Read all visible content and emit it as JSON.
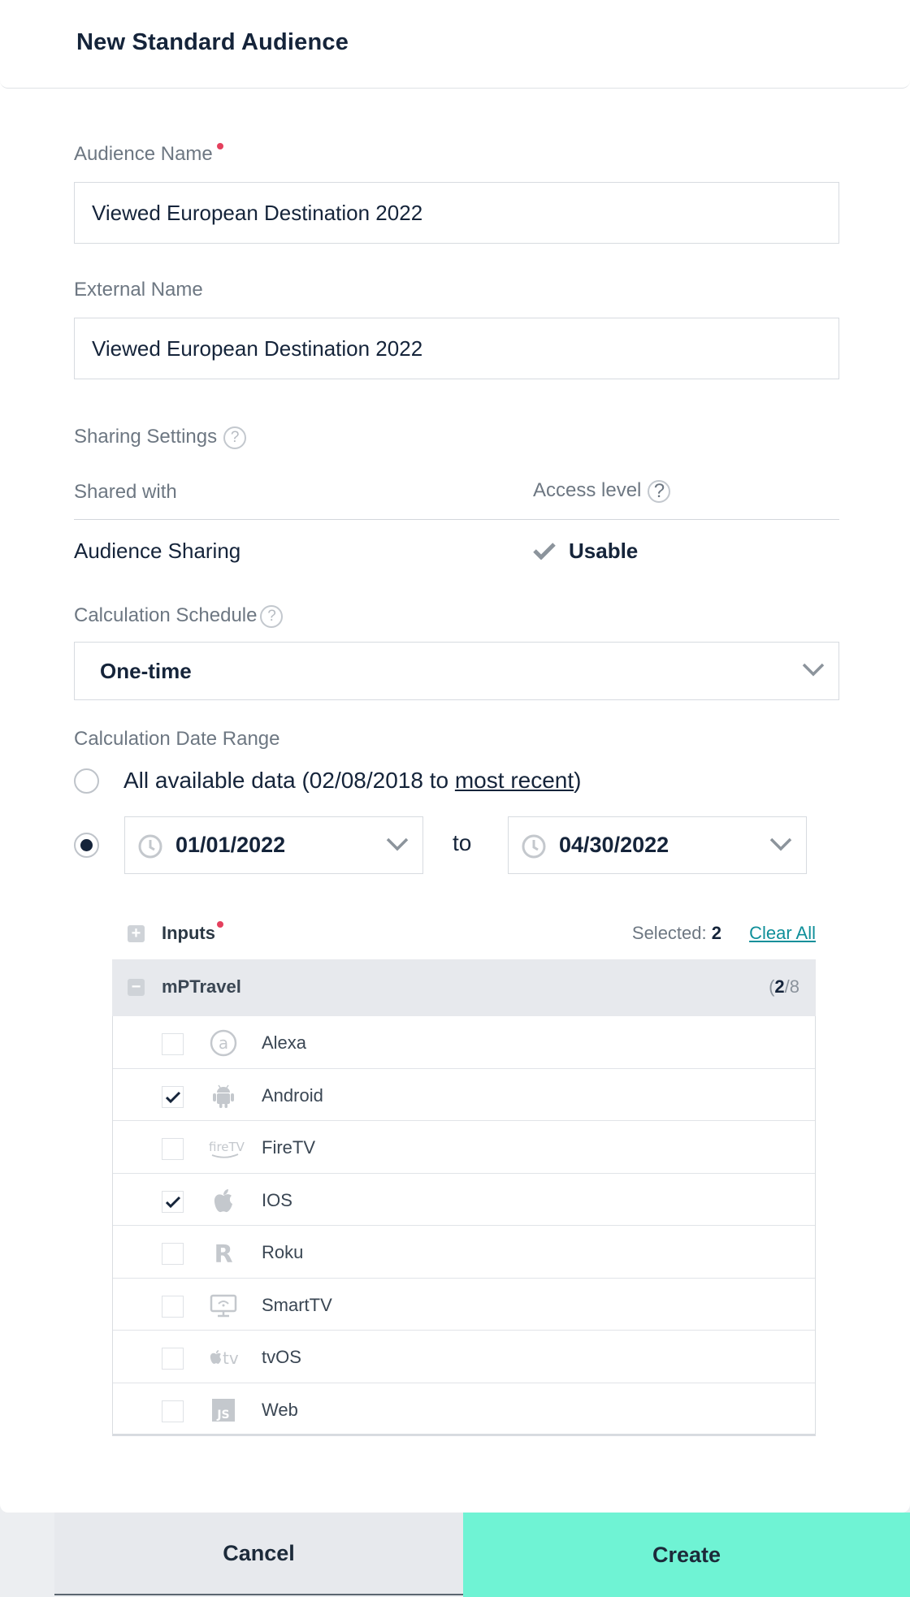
{
  "dialog": {
    "title": "New Standard Audience"
  },
  "audience_name": {
    "label": "Audience Name",
    "value": "Viewed European Destination 2022"
  },
  "external_name": {
    "label": "External Name",
    "value": "Viewed European Destination 2022"
  },
  "sharing": {
    "label": "Sharing Settings",
    "col_shared_with": "Shared with",
    "col_access_level": "Access level",
    "rows": [
      {
        "shared_with": "Audience Sharing",
        "access_level": "Usable"
      }
    ]
  },
  "calculation_schedule": {
    "label": "Calculation Schedule",
    "value": "One-time"
  },
  "date_range": {
    "label": "Calculation Date Range",
    "option_all_prefix": "All available data (02/08/2018 to ",
    "option_all_link": "most recent",
    "option_all_suffix": ")",
    "selected_option": "custom",
    "start_date": "01/01/2022",
    "to_label": "to",
    "end_date": "04/30/2022"
  },
  "inputs": {
    "title": "Inputs",
    "selected_label": "Selected:",
    "selected_count": "2",
    "clear_all": "Clear All",
    "group": {
      "name": "mPTravel",
      "count_open": "(",
      "count_selected": "2",
      "count_total": "/8",
      "platforms": [
        {
          "name": "Alexa",
          "checked": false,
          "icon": "alexa-icon"
        },
        {
          "name": "Android",
          "checked": true,
          "icon": "android-icon"
        },
        {
          "name": "FireTV",
          "checked": false,
          "icon": "firetv-icon"
        },
        {
          "name": "IOS",
          "checked": true,
          "icon": "apple-icon"
        },
        {
          "name": "Roku",
          "checked": false,
          "icon": "roku-icon"
        },
        {
          "name": "SmartTV",
          "checked": false,
          "icon": "smarttv-icon"
        },
        {
          "name": "tvOS",
          "checked": false,
          "icon": "appletv-icon"
        },
        {
          "name": "Web",
          "checked": false,
          "icon": "javascript-icon"
        }
      ]
    }
  },
  "footer": {
    "cancel_label": "Cancel",
    "create_label": "Create"
  },
  "colors": {
    "accent": "#6ff3d4",
    "required": "#e4405d",
    "link": "#0f8f9a",
    "text": "#15243a"
  }
}
